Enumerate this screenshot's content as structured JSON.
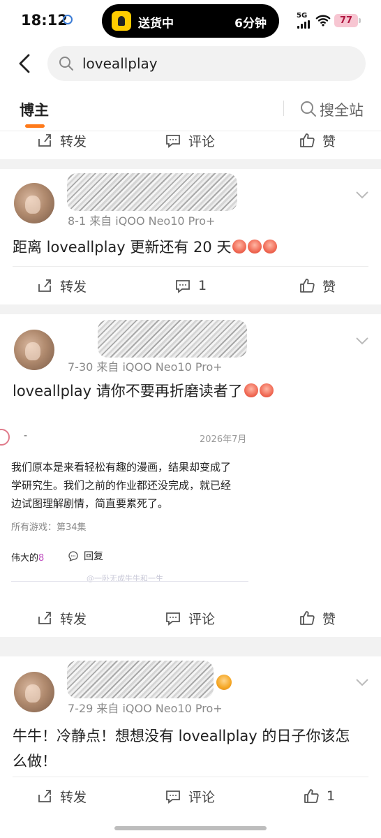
{
  "status_bar": {
    "time": "18:12",
    "island_text": "送货中",
    "island_eta": "6分钟",
    "network": "5G",
    "battery": "77"
  },
  "search": {
    "query": "loveallplay"
  },
  "tabs": {
    "active": "博主",
    "search_all": "搜全站"
  },
  "actions": {
    "repost": "转发",
    "comment": "评论",
    "like": "赞"
  },
  "posts": [
    {
      "meta": "8-1 来自 iQOO Neo10 Pro+",
      "text": "距离 loveallplay 更新还有 20 天",
      "comments": "1",
      "likes": "赞"
    },
    {
      "meta": "7-30 来自 iQOO Neo10 Pro+",
      "text": "loveallplay 请你不要再折磨读者了",
      "comments": "评论",
      "likes": "赞",
      "quote": {
        "dash": "-",
        "date": "2026年7月",
        "lines": [
          "我们原本是来看轻松有趣的漫画，结果却变成了",
          "学研究生。我们之前的作业都还没完成，就已经",
          "边试图理解剧情，简直要累死了。"
        ],
        "tag": "所有游戏：第34集",
        "like_prefix": "伟大的",
        "like_count": "8",
        "reply": "回复",
        "watermark": "@一卧无成牛牛和一生"
      }
    },
    {
      "meta": "7-29 来自 iQOO Neo10 Pro+",
      "text_line1": "牛牛！冷静点！想想没有 loveallplay 的日子你该怎",
      "text_line2": "么做！",
      "comments": "评论",
      "likes": "1"
    }
  ]
}
